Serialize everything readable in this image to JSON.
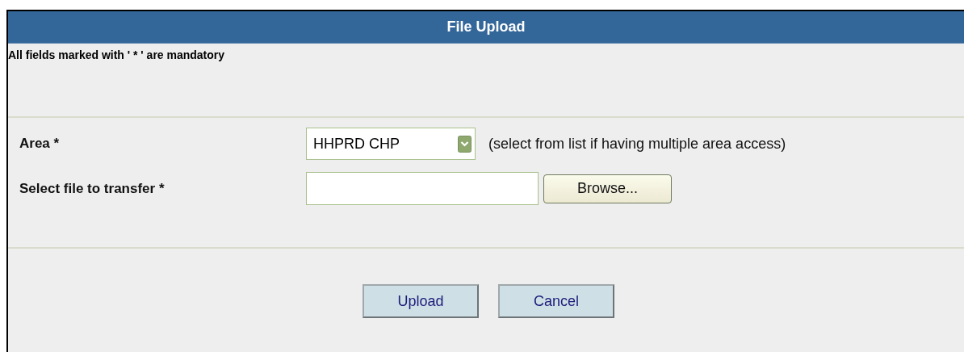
{
  "header": {
    "title": "File Upload"
  },
  "note": "All fields marked with ' * ' are mandatory",
  "form": {
    "area": {
      "label": "Area *",
      "value": "HHPRD CHP",
      "hint": "(select from list if having multiple area access)"
    },
    "file": {
      "label": "Select file to transfer *",
      "browse": "Browse..."
    }
  },
  "buttons": [
    "Upload",
    "Cancel"
  ]
}
